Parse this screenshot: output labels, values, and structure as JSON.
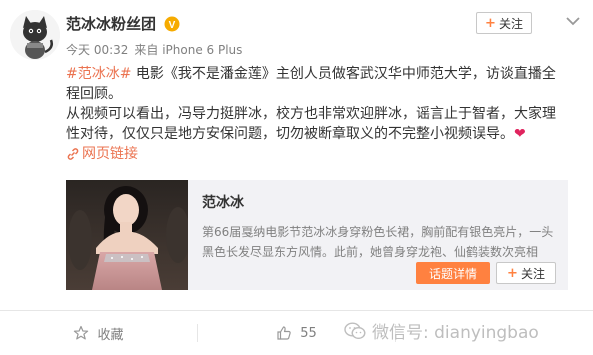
{
  "header": {
    "user_name": "范冰冰粉丝团",
    "time": "今天 00:32",
    "source": "来自 iPhone 6 Plus",
    "follow_label": "关注"
  },
  "post": {
    "topic": "#范冰冰#",
    "line1_text": " 电影《我不是潘金莲》主创人员做客武汉华中师范大学，访谈直播全程回顾。",
    "line2_text": "从视频可以看出，冯导力挺胖冰，校方也非常欢迎胖冰，谣言止于智者，大家理性对待，仅仅只是地方安保问题，切勿被断章取义的不完整小视频误导。",
    "heart": "❤",
    "link_label": "网页链接"
  },
  "card": {
    "title": "范冰冰",
    "description": "第66届戛纳电影节范冰冰身穿粉色长裙，胸前配有银色亮片，一头黑色长发尽显东方风情。此前，她曾身穿龙袍、仙鹤装数次亮相",
    "detail_label": "话题详情",
    "follow_label": "关注"
  },
  "footer": {
    "favorite_label": "收藏",
    "like_count": "55"
  },
  "watermark": {
    "text": "微信号: dianyingbao"
  },
  "colors": {
    "accent": "#eb7350",
    "button_orange": "#ff8140",
    "verified_yellow": "#f6ab00",
    "card_bg": "#f2f2f5",
    "muted_text": "#808080"
  },
  "icons": {
    "verified": "verified-badge-icon",
    "menu": "chevron-down-icon",
    "link": "link-icon",
    "favorite": "star-icon",
    "like": "thumbs-up-icon",
    "watermark": "wechat-icon"
  }
}
